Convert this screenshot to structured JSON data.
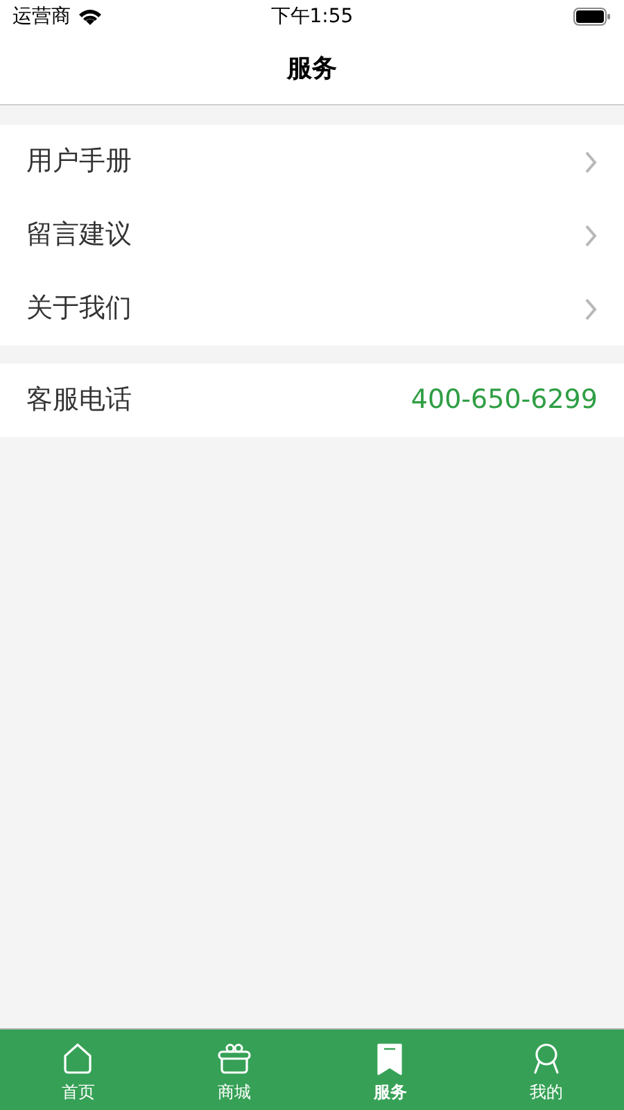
{
  "status_bar": {
    "carrier": "运营商",
    "time": "下午1:55"
  },
  "nav": {
    "title": "服务"
  },
  "menu": [
    {
      "label": "用户手册"
    },
    {
      "label": "留言建议"
    },
    {
      "label": "关于我们"
    }
  ],
  "contact": {
    "label": "客服电话",
    "value": "400-650-6299"
  },
  "tabs": [
    {
      "label": "首页",
      "kind": "home",
      "selected": false
    },
    {
      "label": "商城",
      "kind": "basket",
      "selected": false
    },
    {
      "label": "服务",
      "kind": "bookmark",
      "selected": true
    },
    {
      "label": "我的",
      "kind": "person",
      "selected": false
    }
  ]
}
